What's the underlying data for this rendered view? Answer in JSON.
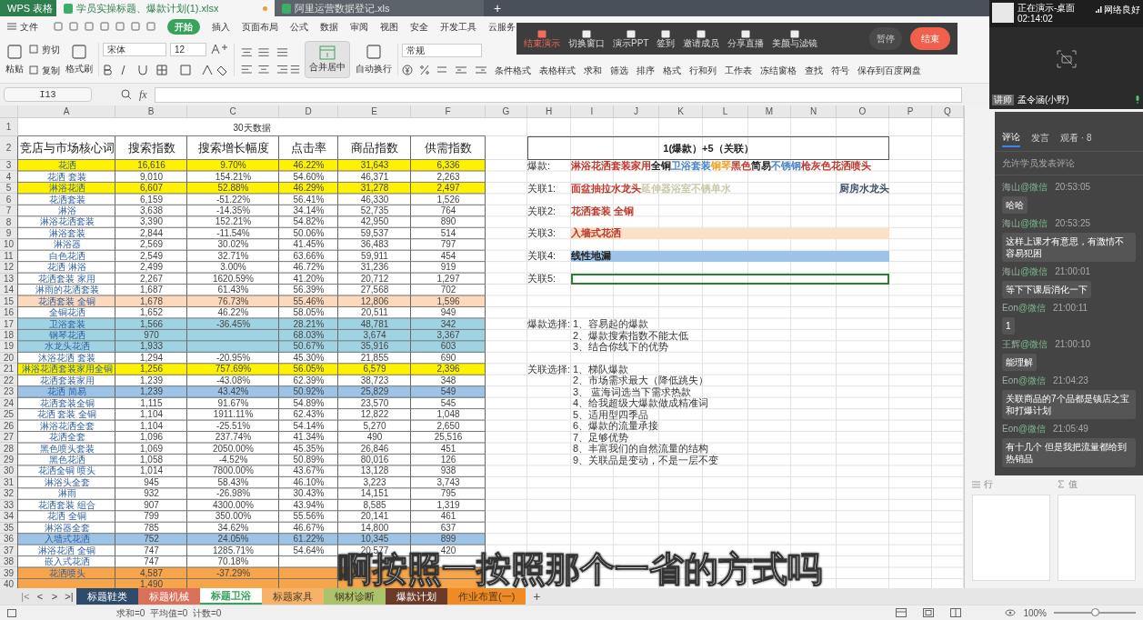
{
  "app_name": "WPS 表格",
  "app_tabs": [
    {
      "label": "学员实操标题、爆款计划(1).xlsx",
      "selected": true
    },
    {
      "label": "阿里运营数据登记.xls",
      "selected": false
    }
  ],
  "new_tab": "+",
  "menu": {
    "file": "文件",
    "tabs": [
      {
        "label": "开始",
        "selected": true
      },
      {
        "label": "插入",
        "selected": false
      },
      {
        "label": "页面布局",
        "selected": false
      },
      {
        "label": "公式",
        "selected": false
      },
      {
        "label": "数据",
        "selected": false
      },
      {
        "label": "审阅",
        "selected": false
      },
      {
        "label": "视图",
        "selected": false
      },
      {
        "label": "安全",
        "selected": false
      },
      {
        "label": "开发工具",
        "selected": false
      },
      {
        "label": "云服务",
        "selected": false
      }
    ]
  },
  "ribbon": {
    "paste": "粘贴",
    "cut": "剪切",
    "copy": "复制",
    "format_painter": "格式刷",
    "font": "宋体",
    "font_size": "12",
    "merge": "合并居中",
    "wrap": "自动换行",
    "number_format": "常规",
    "commands": [
      "条件格式",
      "表格样式",
      "求和",
      "筛选",
      "排序",
      "格式",
      "行和列",
      "工作表",
      "冻结窗格",
      "查找",
      "符号",
      "保存到百度网盘"
    ]
  },
  "presentation_bar": {
    "tools": [
      "结束演示",
      "切换窗口",
      "演示PPT",
      "签到",
      "邀请成员",
      "分享直播",
      "美颜与滤镜"
    ],
    "pause": "暂停",
    "end": "结束"
  },
  "formula_bar": {
    "cell_ref": "I13",
    "fx": "fx"
  },
  "columns": [
    "A",
    "B",
    "C",
    "D",
    "E",
    "F",
    "G",
    "H",
    "I",
    "J",
    "K",
    "L",
    "M",
    "N",
    "O",
    "P",
    "Q"
  ],
  "row_numbers": [
    "1",
    "2",
    "3",
    "4",
    "5",
    "6",
    "7",
    "8",
    "9",
    "10",
    "11",
    "12",
    "13",
    "14",
    "15",
    "16",
    "17",
    "18",
    "19",
    "20",
    "21",
    "22",
    "23",
    "24",
    "25",
    "26",
    "27",
    "28",
    "29",
    "30",
    "31",
    "32",
    "33",
    "34",
    "35",
    "36",
    "37",
    "38",
    "39",
    "40"
  ],
  "sheet": {
    "title": "30天数据",
    "headers": [
      "竞店与市场核心词",
      "搜索指数",
      "搜索增长幅度",
      "点击率",
      "商品指数",
      "供需指数"
    ],
    "rows": [
      {
        "color": "#fff200",
        "cells": [
          "花洒",
          "16,616",
          "9.70%",
          "46.22%",
          "31,643",
          "6,336"
        ]
      },
      {
        "cells": [
          "花洒 套装",
          "9,010",
          "154.21%",
          "54.60%",
          "46,371",
          "2,263"
        ]
      },
      {
        "color": "#fff200",
        "cells": [
          "淋浴花洒",
          "6,607",
          "52.88%",
          "46.29%",
          "31,278",
          "2,497"
        ]
      },
      {
        "cells": [
          "花洒套装",
          "6,159",
          "-51.22%",
          "56.41%",
          "46,330",
          "1,526"
        ]
      },
      {
        "cells": [
          "淋浴",
          "3,638",
          "-14.35%",
          "34.14%",
          "52,735",
          "764"
        ]
      },
      {
        "cells": [
          "淋浴花洒套装",
          "3,390",
          "152.21%",
          "54.82%",
          "42,950",
          "890"
        ]
      },
      {
        "cells": [
          "淋浴套装",
          "2,844",
          "-11.54%",
          "50.06%",
          "59,537",
          "514"
        ]
      },
      {
        "cells": [
          "淋浴器",
          "2,569",
          "30.02%",
          "41.45%",
          "36,483",
          "797"
        ]
      },
      {
        "cells": [
          "白色花洒",
          "2,549",
          "32.71%",
          "63.66%",
          "59,911",
          "454"
        ]
      },
      {
        "cells": [
          "花洒 淋浴",
          "2,499",
          "3.00%",
          "46.72%",
          "31,236",
          "919"
        ]
      },
      {
        "cells": [
          "花洒套装 家用",
          "2,267",
          "1620.59%",
          "41.20%",
          "20,712",
          "1,297"
        ]
      },
      {
        "cells": [
          "淋雨的花洒套装",
          "1,687",
          "61.43%",
          "56.39%",
          "27,568",
          "702"
        ]
      },
      {
        "color": "#fcd9bd",
        "cells": [
          "花洒套装 全铜",
          "1,678",
          "76.73%",
          "55.46%",
          "12,806",
          "1,596"
        ]
      },
      {
        "cells": [
          "全铜花洒",
          "1,652",
          "46.22%",
          "58.05%",
          "20,511",
          "949"
        ]
      },
      {
        "color": "#9fd3e3",
        "cells": [
          "卫浴套装",
          "1,566",
          "-36.45%",
          "28.21%",
          "48,781",
          "342"
        ]
      },
      {
        "color": "#9fd3e3",
        "cells": [
          "钢琴花洒",
          "970",
          null,
          "68.03%",
          "3,674",
          "3,367"
        ]
      },
      {
        "color": "#9fd3e3",
        "cells": [
          "水龙头花洒",
          "1,933",
          null,
          "50.67%",
          "35,916",
          "603"
        ]
      },
      {
        "cells": [
          "沐浴花洒 套装",
          "1,294",
          "-20.95%",
          "45.30%",
          "21,855",
          "690"
        ]
      },
      {
        "color": "#fff200",
        "cells": [
          "淋浴花洒套装家用全铜",
          "1,256",
          "757.69%",
          "56.05%",
          "6,579",
          "2,396"
        ]
      },
      {
        "cells": [
          "花洒套装家用",
          "1,239",
          "-43.08%",
          "62.39%",
          "38,723",
          "348"
        ]
      },
      {
        "color": "#9dc3e6",
        "cells": [
          "花洒 简易",
          "1,239",
          "43.42%",
          "50.92%",
          "25,829",
          "549"
        ]
      },
      {
        "cells": [
          "花洒套装全铜",
          "1,115",
          "91.67%",
          "54.89%",
          "23,570",
          "545"
        ]
      },
      {
        "cells": [
          "花洒 套装 全铜",
          "1,104",
          "1911.11%",
          "62.43%",
          "12,822",
          "1,048"
        ]
      },
      {
        "cells": [
          "淋浴花洒全套",
          "1,104",
          "-25.51%",
          "54.14%",
          "5,270",
          "2,650"
        ]
      },
      {
        "cells": [
          "花洒全套",
          "1,096",
          "237.74%",
          "41.34%",
          "490",
          "25,516"
        ]
      },
      {
        "cells": [
          "黑色喷头套装",
          "1,069",
          "2050.00%",
          "45.35%",
          "26,846",
          "451"
        ]
      },
      {
        "cells": [
          "黑色花洒",
          "1,058",
          "-4.52%",
          "50.89%",
          "80,016",
          "126"
        ]
      },
      {
        "cells": [
          "花洒全铜 喷头",
          "1,014",
          "7800.00%",
          "43.67%",
          "13,128",
          "938"
        ]
      },
      {
        "cells": [
          "淋浴头全套",
          "945",
          "58.43%",
          "46.10%",
          "3,223",
          "3,743"
        ]
      },
      {
        "cells": [
          "淋雨",
          "932",
          "-26.98%",
          "30.43%",
          "14,151",
          "795"
        ]
      },
      {
        "cells": [
          "花洒套装 组合",
          "907",
          "4300.00%",
          "43.94%",
          "8,585",
          "1,319"
        ]
      },
      {
        "cells": [
          "花洒 全铜",
          "799",
          "350.00%",
          "55.56%",
          "20,141",
          "461"
        ]
      },
      {
        "cells": [
          "淋浴器全套",
          "785",
          "34.62%",
          "46.67%",
          "14,800",
          "637"
        ]
      },
      {
        "color": "#9dc3e6",
        "cells": [
          "入墙式花洒",
          "752",
          "24.05%",
          "61.22%",
          "10,345",
          "899"
        ]
      },
      {
        "cells": [
          "淋浴花洒 全铜",
          "747",
          "1285.71%",
          "54.64%",
          "20,577",
          "420"
        ]
      },
      {
        "cells": [
          "嵌入式花洒",
          "747",
          "70.18%",
          null,
          null,
          null
        ]
      },
      {
        "color": "#f6a54a",
        "cells": [
          "花洒喷头",
          "4,587",
          "-37.29%",
          null,
          null,
          null
        ]
      },
      {
        "color": "#f6a54a",
        "cells": [
          null,
          "1,490",
          null,
          null,
          null,
          null
        ]
      }
    ]
  },
  "plan": {
    "title": "1(爆款）+5（关联）",
    "notes": [
      {
        "label": "爆款:",
        "segments": [
          {
            "text": "淋浴花洒套装家用",
            "color": "#c0392b"
          },
          {
            "text": "全铜",
            "color": "#222222"
          },
          {
            "text": "卫浴套装",
            "color": "#4a86c8"
          },
          {
            "text": "铜琴",
            "color": "#f0a020"
          },
          {
            "text": "黑色",
            "color": "#c0392b"
          },
          {
            "text": "简易",
            "color": "#222222"
          },
          {
            "text": "不锈钢",
            "color": "#4a86c8"
          },
          {
            "text": "枪灰色花洒喷头",
            "color": "#c0392b"
          }
        ]
      },
      {
        "label": "关联1:",
        "segments": [
          {
            "text": "面盆抽拉水龙头",
            "color": "#c0392b"
          },
          {
            "text": "延伸器浴室不锈单水",
            "color": "#c9c9a8"
          }
        ],
        "right": {
          "text": "厨房水龙头",
          "color": "#44546a"
        }
      },
      {
        "label": "关联2:",
        "segments": [
          {
            "text": "花洒套装  全铜",
            "color": "#c0392b"
          }
        ]
      },
      {
        "label": "关联3:",
        "color": "#fde0c8",
        "segments": [
          {
            "text": "入墙式花洒",
            "color": "#c0392b"
          }
        ]
      },
      {
        "label": "关联4:",
        "color": "#9dc3e6",
        "segments": [
          {
            "text": "线性地漏"
          }
        ]
      },
      {
        "label": "关联5:",
        "selected": true
      },
      {
        "label": "爆款选择:",
        "items": [
          "1、容易起的爆款",
          "2、爆款搜索指数不能太低",
          "3、结合你线下的优势"
        ]
      },
      {
        "label": "关联选择:",
        "items": [
          "1、梯队爆款",
          "2、市场需求最大（降低跳失）",
          "3、  蓝海词选当下需求热款",
          "4、给我超级大爆款做成精准词",
          "5、适用型四季品",
          "6、爆款的流量承接",
          "7、足够优势",
          "8、丰富我们的自然流量的结构",
          "9、关联品是变动，不是一层不变"
        ]
      }
    ]
  },
  "sheet_tabs": [
    {
      "label": "标题鞋类",
      "color": "#2e4a6b",
      "selected": false
    },
    {
      "label": "标题机械",
      "color": "#d9705a",
      "selected": false
    },
    {
      "label": "标题卫浴",
      "color": "#ffffff",
      "selected": true
    },
    {
      "label": "标题家具",
      "color": "#f6b26b",
      "selected": false
    },
    {
      "label": "钢材诊断",
      "color": "#a9c26b",
      "selected": false
    },
    {
      "label": "爆款计划",
      "color": "#6b3a2a",
      "selected": false
    },
    {
      "label": "作业布置(一)",
      "color": "#f08a24",
      "selected": false
    }
  ],
  "tab_nav": [
    "|<",
    "<",
    ">",
    ">|"
  ],
  "add_sheet": "+",
  "status_bar": {
    "stats": "求和=0  平均值=0  计数=0",
    "zoom": "100%",
    "zoom_slider": {
      "level": 0.5
    }
  },
  "pivot_panel": {
    "rows_label": "行",
    "values_label": "值"
  },
  "live": {
    "status": "正在演示-桌面",
    "time": "02:14:02",
    "network": "网络良好",
    "role": "讲师",
    "presenter": "孟令涵(小野)",
    "tabs": [
      {
        "label": "评论",
        "selected": true
      },
      {
        "label": "发言",
        "selected": false
      },
      {
        "label": "观看 · 8",
        "selected": false
      }
    ],
    "setting": "允许学员发表评论",
    "messages": [
      {
        "user": "海山",
        "source": "@微信",
        "time": "20:53:05",
        "text": "哈哈"
      },
      {
        "user": "海山",
        "source": "@微信",
        "time": "20:53:25",
        "text": "这样上课才有意思，有激情不容易犯困"
      },
      {
        "user": "海山",
        "source": "@微信",
        "time": "21:00:01",
        "text": "等下下课后消化一下"
      },
      {
        "user": "Eon",
        "source": "@微信",
        "time": "21:00:11",
        "text": "1"
      },
      {
        "user": "王辉",
        "source": "@微信",
        "time": "21:00:10",
        "text": "能理解"
      },
      {
        "user": "Eon",
        "source": "@微信",
        "time": "21:04:23",
        "text": "关联商品的7个品都是镇店之宝和打爆计划"
      },
      {
        "user": "Eon",
        "source": "@微信",
        "time": "21:05:49",
        "text": "有十几个 但是我把流量都给到热销品"
      }
    ]
  },
  "subtitle": "啊按照一按照那个一省的方式吗"
}
